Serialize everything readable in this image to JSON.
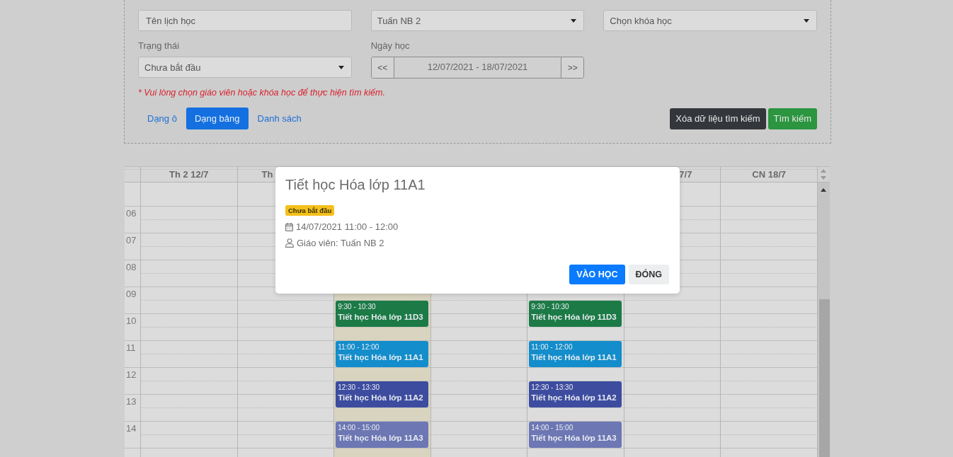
{
  "filters": {
    "name_field": {
      "placeholder": "Tên lịch học"
    },
    "teacher_select": {
      "value": "Tuấn NB 2"
    },
    "course_select": {
      "value": "Chọn khóa học"
    },
    "status_label": "Trạng thái",
    "status_select": {
      "value": "Chưa bắt đầu"
    },
    "date_label": "Ngày học",
    "date_range": {
      "prev": "<<",
      "value": "12/07/2021 - 18/07/2021",
      "next": ">>"
    },
    "warning": "* Vui lòng chọn giáo viên hoặc khóa học để thực hiện tìm kiếm.",
    "view_modes": [
      {
        "label": "Dạng ô",
        "selected": false
      },
      {
        "label": "Dạng bảng",
        "selected": true
      },
      {
        "label": "Danh sách",
        "selected": false
      }
    ],
    "buttons": [
      {
        "label": "Xóa dữ liệu tìm kiếm",
        "kind": "secondary"
      },
      {
        "label": "Tìm kiếm",
        "kind": "primary"
      }
    ]
  },
  "calendar": {
    "hours": [
      "06",
      "07",
      "08",
      "09",
      "10",
      "11",
      "12",
      "13",
      "14"
    ],
    "days": [
      {
        "header": "Th 2 12/7",
        "kind": "whole",
        "today": false
      },
      {
        "header": "Th",
        "kind": "head_shown",
        "today": false
      },
      {
        "kind": "hidden",
        "today": true,
        "events": [
          {
            "time": "9:30 - 10:30",
            "title": "Tiết học Hóa lớp 11D3",
            "color": "#1c7a47"
          },
          {
            "time": "11:00 - 12:00",
            "title": "Tiết học Hóa lớp 11A1",
            "color": "#138dcb"
          },
          {
            "time": "12:30 - 13:30",
            "title": "Tiết học Hóa lớp 11A2",
            "color": "#3d4c9f"
          },
          {
            "time": "14:00 - 15:00",
            "title": "Tiết học Hóa lớp 11A3",
            "color": "#6c77b3"
          }
        ]
      },
      {
        "kind": "hidden",
        "today": false
      },
      {
        "kind": "hidden",
        "today": false,
        "events": [
          {
            "time": "9:30 - 10:30",
            "title": "Tiết học Hóa lớp 11D3",
            "color": "#1c7a47"
          },
          {
            "time": "11:00 - 12:00",
            "title": "Tiết học Hóa lớp 11A1",
            "color": "#138dcb"
          },
          {
            "time": "12:30 - 13:30",
            "title": "Tiết học Hóa lớp 11A2",
            "color": "#3d4c9f"
          },
          {
            "time": "14:00 - 15:00",
            "title": "Tiết học Hóa lớp 11A3",
            "color": "#6c77b3"
          }
        ]
      },
      {
        "header": "7/7",
        "kind": "tail_shown",
        "today": false
      },
      {
        "header": "CN 18/7",
        "kind": "whole",
        "today": false
      }
    ]
  },
  "modal": {
    "title": "Tiết học Hóa lớp 11A1",
    "status_badge": "Chưa bắt đầu",
    "datetime": "14/07/2021 11:00 - 12:00",
    "teacher": "Giáo viên: Tuấn NB 2",
    "buttons": [
      {
        "label": "VÀO HỌC",
        "kind": "primary"
      },
      {
        "label": "ĐÓNG",
        "kind": "light"
      }
    ]
  }
}
